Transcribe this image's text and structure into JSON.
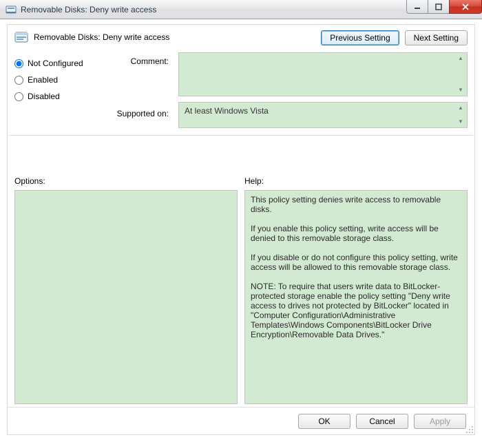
{
  "window": {
    "title": "Removable Disks: Deny write access"
  },
  "header": {
    "policy_title": "Removable Disks: Deny write access",
    "prev_label": "Previous Setting",
    "next_label": "Next Setting"
  },
  "state": {
    "options": [
      {
        "label": "Not Configured",
        "checked": true
      },
      {
        "label": "Enabled",
        "checked": false
      },
      {
        "label": "Disabled",
        "checked": false
      }
    ],
    "comment_label": "Comment:",
    "comment_value": "",
    "supported_label": "Supported on:",
    "supported_value": "At least Windows Vista"
  },
  "panes": {
    "options_heading": "Options:",
    "options_body": "",
    "help_heading": "Help:",
    "help_body": "This policy setting denies write access to removable disks.\n\nIf you enable this policy setting, write access will be denied to this removable storage class.\n\nIf you disable or do not configure this policy setting, write access will be allowed to this removable storage class.\n\nNOTE: To require that users write data to BitLocker-protected storage enable the policy setting \"Deny write access to drives not protected by BitLocker\" located in \"Computer Configuration\\Administrative Templates\\Windows Components\\BitLocker Drive Encryption\\Removable Data Drives.\""
  },
  "footer": {
    "ok": "OK",
    "cancel": "Cancel",
    "apply": "Apply"
  }
}
